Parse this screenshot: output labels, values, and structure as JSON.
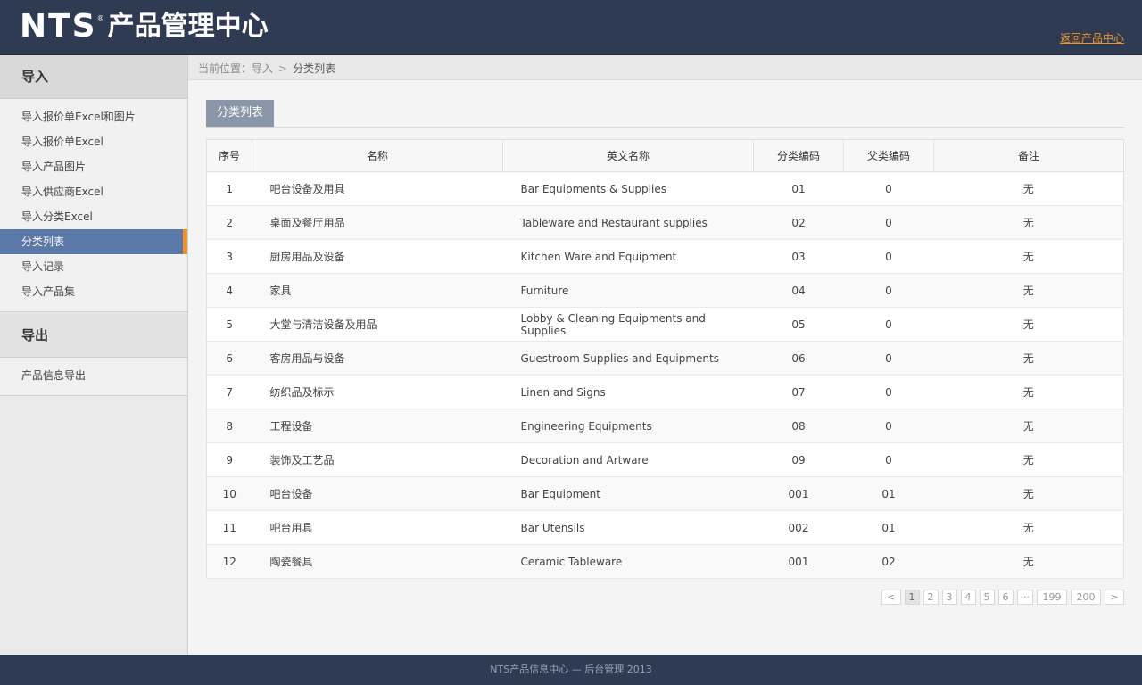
{
  "header": {
    "logo_brand": "NTS",
    "logo_reg": "®",
    "logo_title": "产品管理中心",
    "back_link": "返回产品中心"
  },
  "sidebar": {
    "sections": [
      {
        "title": "导入",
        "items": [
          "导入报价单Excel和图片",
          "导入报价单Excel",
          "导入产品图片",
          "导入供应商Excel",
          "导入分类Excel",
          "分类列表",
          "导入记录",
          "导入产品集"
        ]
      },
      {
        "title": "导出",
        "items": [
          "产品信息导出"
        ]
      }
    ],
    "active_item": "分类列表"
  },
  "breadcrumb": {
    "prefix": "当前位置：",
    "parent": "导入",
    "separator": ">",
    "current": "分类列表"
  },
  "main": {
    "tab_label": "分类列表",
    "table": {
      "columns": [
        "序号",
        "名称",
        "英文名称",
        "分类编码",
        "父类编码",
        "备注"
      ],
      "rows": [
        [
          "1",
          "吧台设备及用具",
          "Bar Equipments & Supplies",
          "01",
          "0",
          "无"
        ],
        [
          "2",
          "桌面及餐厅用品",
          "Tableware and Restaurant supplies",
          "02",
          "0",
          "无"
        ],
        [
          "3",
          "厨房用品及设备",
          "Kitchen Ware and Equipment",
          "03",
          "0",
          "无"
        ],
        [
          "4",
          "家具",
          "Furniture",
          "04",
          "0",
          "无"
        ],
        [
          "5",
          "大堂与清洁设备及用品",
          "Lobby & Cleaning Equipments and Supplies",
          "05",
          "0",
          "无"
        ],
        [
          "6",
          "客房用品与设备",
          "Guestroom Supplies and Equipments",
          "06",
          "0",
          "无"
        ],
        [
          "7",
          "纺织品及标示",
          "Linen and Signs",
          "07",
          "0",
          "无"
        ],
        [
          "8",
          "工程设备",
          "Engineering Equipments",
          "08",
          "0",
          "无"
        ],
        [
          "9",
          "装饰及工艺品",
          "Decoration and Artware",
          "09",
          "0",
          "无"
        ],
        [
          "10",
          "吧台设备",
          "Bar Equipment",
          "001",
          "01",
          "无"
        ],
        [
          "11",
          "吧台用具",
          "Bar Utensils",
          "002",
          "01",
          "无"
        ],
        [
          "12",
          "陶瓷餐具",
          "Ceramic Tableware",
          "001",
          "02",
          "无"
        ]
      ]
    }
  },
  "pagination": {
    "prev": "<",
    "pages": [
      "1",
      "2",
      "3",
      "4",
      "5",
      "6",
      "···",
      "199",
      "200"
    ],
    "current": "1",
    "next": ">"
  },
  "footer": {
    "text": "NTS产品信息中心 — 后台管理 2013"
  },
  "colors": {
    "header_bg": "#2f3b52",
    "accent_orange": "#f0922a",
    "active_nav_bg": "#5a78a8",
    "tab_bg": "#8b97a8"
  }
}
